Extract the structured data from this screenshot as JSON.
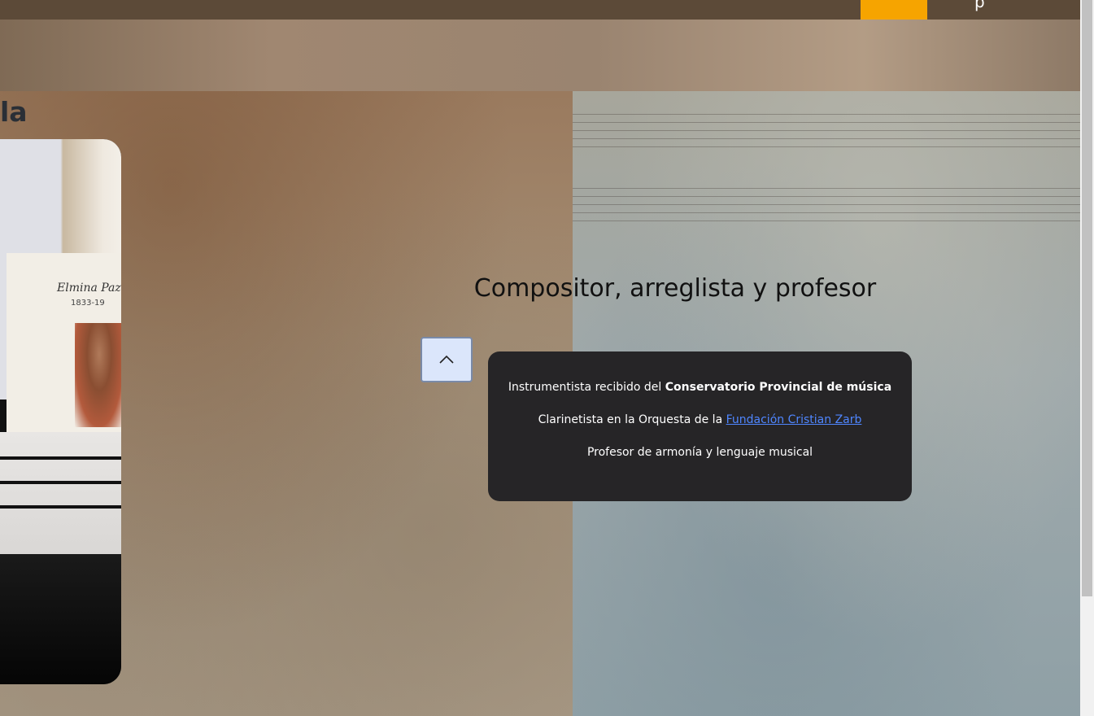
{
  "nav": {
    "fragment_text": "p"
  },
  "section": {
    "title_fragment": "la"
  },
  "photo": {
    "poster_name": "Elmina Paz",
    "poster_years": "1833-19"
  },
  "hero": {
    "title": "Compositor, arreglista y profesor"
  },
  "scroll_top": {
    "icon": "chevron-up-icon"
  },
  "info": {
    "line1_prefix": "Instrumentista recibido del ",
    "line1_bold": "Conservatorio Provincial de música",
    "line2_prefix": "Clarinetista en la Orquesta de la ",
    "line2_link": "Fundación Cristian Zarb",
    "line3": "Profesor de armonía y lenguaje musical"
  },
  "colors": {
    "accent": "#f6a400",
    "card_bg": "#262527",
    "link": "#4f86ff"
  }
}
